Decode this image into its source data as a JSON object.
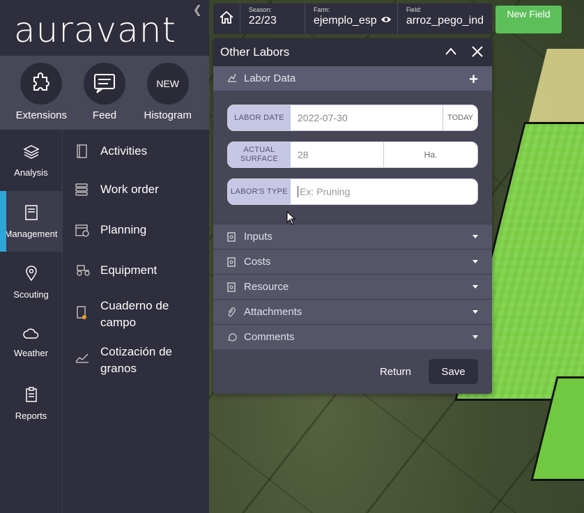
{
  "brand": {
    "logo_text": "auravant"
  },
  "quick_actions": [
    {
      "label": "Extensions",
      "icon": "puzzle-icon"
    },
    {
      "label": "Feed",
      "icon": "chat-icon"
    },
    {
      "label": "Histogram",
      "icon": "new-badge",
      "badge": "NEW"
    }
  ],
  "nav": [
    {
      "label": "Analysis",
      "icon": "layers-icon",
      "active": false
    },
    {
      "label": "Management",
      "icon": "notebook-icon",
      "active": true
    },
    {
      "label": "Scouting",
      "icon": "pin-icon",
      "active": false
    },
    {
      "label": "Weather",
      "icon": "cloud-icon",
      "active": false
    },
    {
      "label": "Reports",
      "icon": "clipboard-icon",
      "active": false
    }
  ],
  "management_menu": [
    {
      "label": "Activities",
      "icon": "book-icon"
    },
    {
      "label": "Work order",
      "icon": "stack-icon"
    },
    {
      "label": "Planning",
      "icon": "calendar-icon"
    },
    {
      "label": "Equipment",
      "icon": "tractor-icon"
    },
    {
      "label": "Cuaderno de campo",
      "icon": "field-notebook-icon"
    },
    {
      "label": "Cotización de granos",
      "icon": "chart-icon"
    }
  ],
  "topbar": {
    "season_key": "Season:",
    "season_value": "22/23",
    "farm_key": "Farm:",
    "farm_value": "ejemplo_esp",
    "field_key": "Field:",
    "field_value": "arroz_pego_ind",
    "new_field_label": "New Field"
  },
  "panel": {
    "title": "Other Labors",
    "labor_section": "Labor Data",
    "fields": {
      "labor_date_label": "LABOR DATE",
      "labor_date_value": "2022-07-30",
      "today_label": "TODAY",
      "surface_label": "ACTUAL SURFACE",
      "surface_value": "28",
      "surface_unit": "Ha.",
      "type_label": "LABOR'S TYPE",
      "type_placeholder": "Ex: Pruning"
    },
    "accordions": [
      {
        "label": "Inputs",
        "icon": "document-icon"
      },
      {
        "label": "Costs",
        "icon": "document-icon"
      },
      {
        "label": "Resource",
        "icon": "document-icon"
      },
      {
        "label": "Attachments",
        "icon": "paperclip-icon"
      },
      {
        "label": "Comments",
        "icon": "comment-icon"
      }
    ],
    "return_label": "Return",
    "save_label": "Save"
  },
  "colors": {
    "accent_blue": "#2ea6d9",
    "new_field_green": "#5cbf5a",
    "sidebar_bg": "#2e2e3c",
    "panel_bg": "#464656"
  }
}
